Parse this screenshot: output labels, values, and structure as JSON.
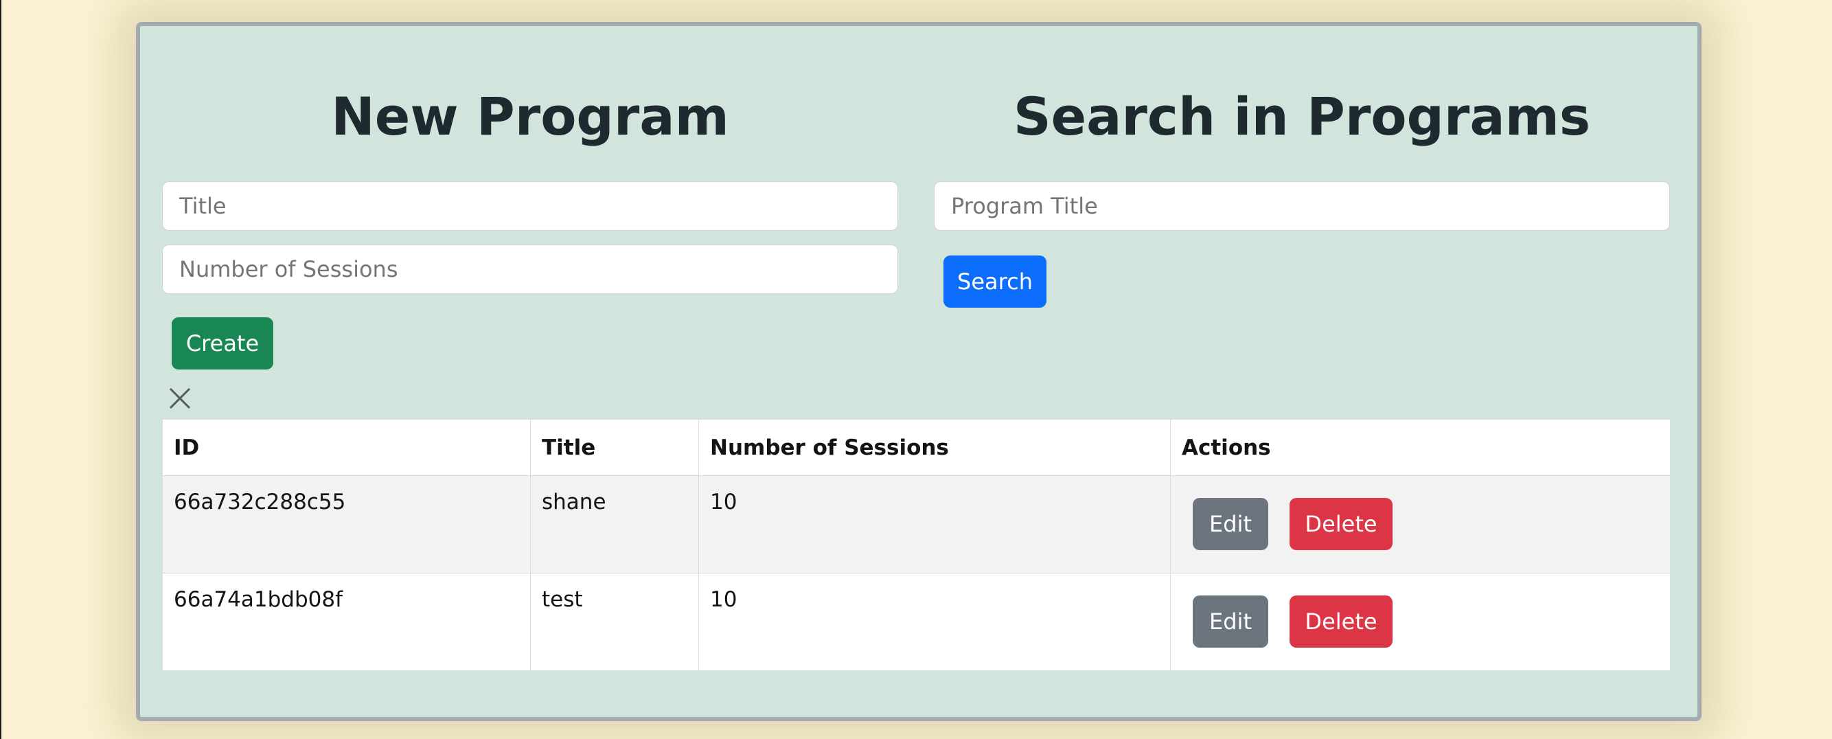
{
  "new_program": {
    "heading": "New Program",
    "title_placeholder": "Title",
    "sessions_placeholder": "Number of Sessions",
    "create_label": "Create"
  },
  "search": {
    "heading": "Search in Programs",
    "placeholder": "Program Title",
    "button_label": "Search"
  },
  "table": {
    "headers": [
      "ID",
      "Title",
      "Number of Sessions",
      "Actions"
    ],
    "rows": [
      {
        "id": "66a732c288c55",
        "title": "shane",
        "sessions": "10",
        "edit_label": "Edit",
        "delete_label": "Delete"
      },
      {
        "id": "66a74a1bdb08f",
        "title": "test",
        "sessions": "10",
        "edit_label": "Edit",
        "delete_label": "Delete"
      }
    ]
  },
  "icons": {
    "close": "close-icon"
  },
  "colors": {
    "panel_background": "#d1e5dc",
    "create_button": "#198754",
    "search_button": "#0d6efd",
    "edit_button": "#6c757d",
    "delete_button": "#dc3545"
  }
}
